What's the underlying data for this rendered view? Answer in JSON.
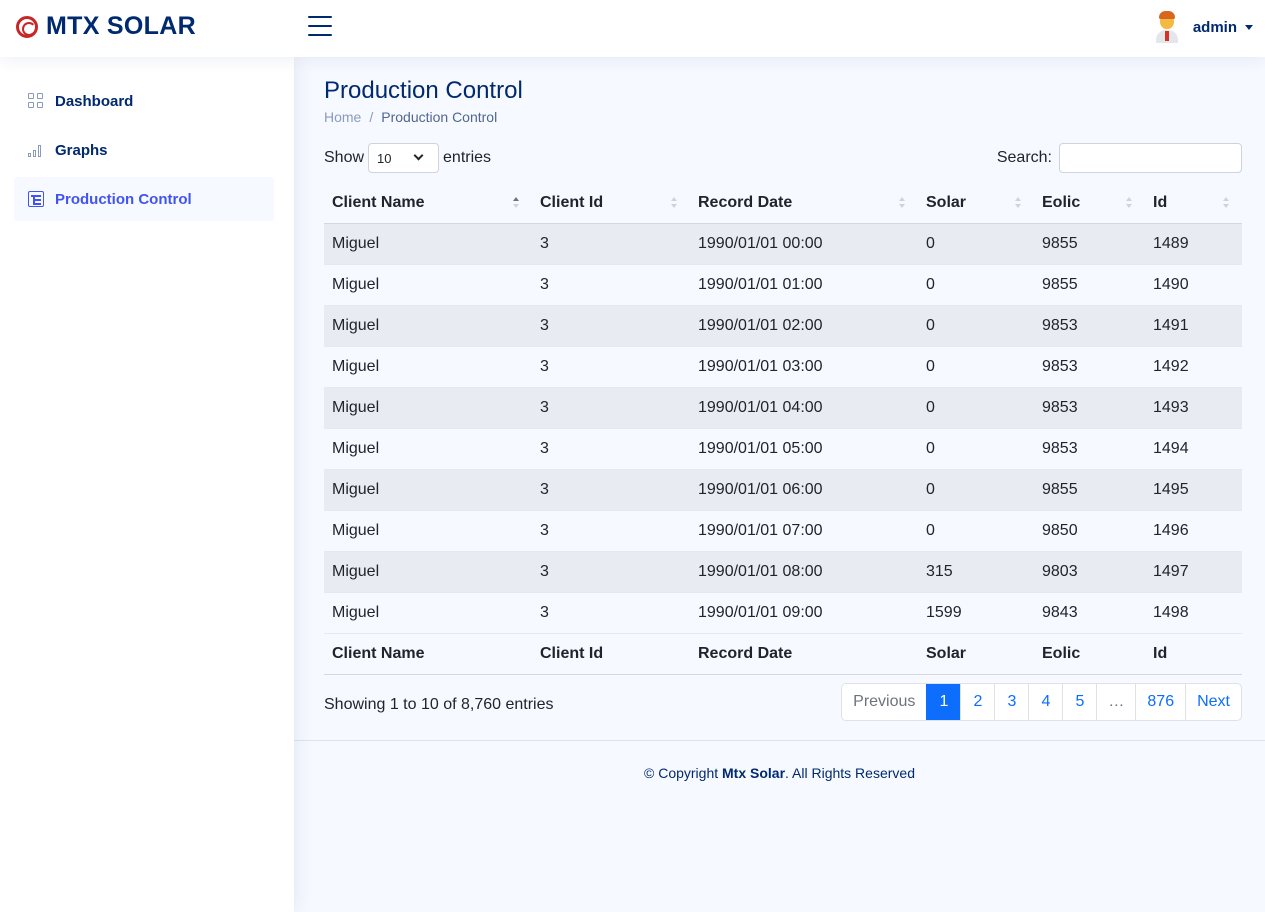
{
  "brand": {
    "name": "MTX SOLAR"
  },
  "user": {
    "name": "admin"
  },
  "sidebar": {
    "items": [
      {
        "label": "Dashboard",
        "icon": "grid-icon"
      },
      {
        "label": "Graphs",
        "icon": "bar-chart-icon"
      },
      {
        "label": "Production Control",
        "icon": "layout-text-sidebar-icon",
        "active": true
      }
    ]
  },
  "page": {
    "title": "Production Control",
    "breadcrumb": {
      "home": "Home",
      "separator": "/",
      "current": "Production Control"
    }
  },
  "table_controls": {
    "show_label": "Show",
    "page_size": "10",
    "entries_label": "entries",
    "search_label": "Search:",
    "search_value": ""
  },
  "table": {
    "columns": [
      "Client Name",
      "Client Id",
      "Record Date",
      "Solar",
      "Eolic",
      "Id"
    ],
    "sorted_column": "Client Name",
    "rows": [
      [
        "Miguel",
        "3",
        "1990/01/01 00:00",
        "0",
        "9855",
        "1489"
      ],
      [
        "Miguel",
        "3",
        "1990/01/01 01:00",
        "0",
        "9855",
        "1490"
      ],
      [
        "Miguel",
        "3",
        "1990/01/01 02:00",
        "0",
        "9853",
        "1491"
      ],
      [
        "Miguel",
        "3",
        "1990/01/01 03:00",
        "0",
        "9853",
        "1492"
      ],
      [
        "Miguel",
        "3",
        "1990/01/01 04:00",
        "0",
        "9853",
        "1493"
      ],
      [
        "Miguel",
        "3",
        "1990/01/01 05:00",
        "0",
        "9853",
        "1494"
      ],
      [
        "Miguel",
        "3",
        "1990/01/01 06:00",
        "0",
        "9855",
        "1495"
      ],
      [
        "Miguel",
        "3",
        "1990/01/01 07:00",
        "0",
        "9850",
        "1496"
      ],
      [
        "Miguel",
        "3",
        "1990/01/01 08:00",
        "315",
        "9803",
        "1497"
      ],
      [
        "Miguel",
        "3",
        "1990/01/01 09:00",
        "1599",
        "9843",
        "1498"
      ]
    ],
    "info": "Showing 1 to 10 of 8,760 entries"
  },
  "pagination": {
    "previous": "Previous",
    "pages": [
      "1",
      "2",
      "3",
      "4",
      "5",
      "…",
      "876"
    ],
    "active_page": "1",
    "next": "Next"
  },
  "footer": {
    "prefix": "© Copyright ",
    "brand": "Mtx Solar",
    "suffix": ". All Rights Reserved"
  },
  "colors": {
    "brand_navy": "#012970",
    "accent_blue": "#4154f1",
    "primary": "#0d6efd",
    "logo_red": "#c62828"
  }
}
